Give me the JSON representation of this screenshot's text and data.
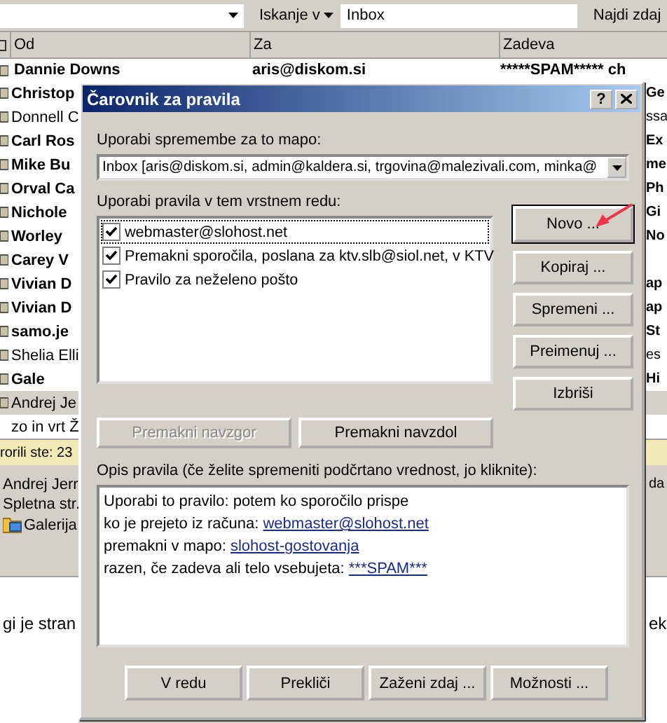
{
  "toolbar": {
    "search_in": "Iskanje v",
    "folder": "Inbox",
    "find_button": "Najdi zdaj"
  },
  "columns": [
    "Od",
    "Za",
    "Zadeva"
  ],
  "first_message": {
    "from": "Dannie Downs",
    "to": "aris@diskom.si",
    "subject": "*****SPAM***** ch",
    "unread": true
  },
  "messages": [
    {
      "from": "Christop",
      "subject": "Ge",
      "unread": true,
      "selected": false
    },
    {
      "from": "Donnell C",
      "subject": "ssa",
      "unread": false,
      "selected": false
    },
    {
      "from": "Carl Ros",
      "subject": "Ex",
      "unread": true,
      "selected": false
    },
    {
      "from": "Mike Bu",
      "subject": "me",
      "unread": true,
      "selected": false
    },
    {
      "from": "Orval Ca",
      "subject": "Ph",
      "unread": true,
      "selected": false
    },
    {
      "from": "Nichole",
      "subject": "Gi",
      "unread": true,
      "selected": false
    },
    {
      "from": "Worley",
      "subject": "No",
      "unread": true,
      "selected": false
    },
    {
      "from": "Carey V",
      "unread": true,
      "selected": false
    },
    {
      "from": "Vivian D",
      "subject": "ap",
      "unread": true,
      "selected": false
    },
    {
      "from": "Vivian D",
      "subject": "ap",
      "unread": true,
      "selected": false
    },
    {
      "from": "samo.je",
      "subject": "St",
      "unread": true,
      "selected": false
    },
    {
      "from": "Shelia Elli",
      "subject": "es",
      "unread": false,
      "selected": false
    },
    {
      "from": "Gale",
      "subject": "Hi",
      "unread": true,
      "selected": false
    },
    {
      "from": "Andrej Je",
      "unread": false,
      "selected": true
    }
  ],
  "reading_pane": {
    "subject": "zo in vrt Ž",
    "info_bar": "rorili ste: 23",
    "from": "Andrej Jerr",
    "from_right": "da",
    "to": "Spletna str.",
    "attachment": "Galerija",
    "body_left": "gi je stran",
    "body_right": "ek"
  },
  "dialog": {
    "title": "Čarovnik za pravila",
    "help": "?",
    "folder_label": "Uporabi spremembe za to mapo:",
    "folder_value": "Inbox [aris@diskom.si, admin@kaldera.si, trgovina@malezivali.com, minka@",
    "rules_label": "Uporabi pravila v tem vrstnem redu:",
    "rules": [
      {
        "name": "webmaster@slohost.net",
        "checked": true,
        "selected": true
      },
      {
        "name": "Premakni sporočila, poslana za ktv.slb@siol.net, v KTV",
        "checked": true,
        "selected": false
      },
      {
        "name": "Pravilo za neželeno pošto",
        "checked": true,
        "selected": false
      }
    ],
    "side_buttons": [
      {
        "label": "Novo ...",
        "default": true
      },
      {
        "label": "Kopiraj ...",
        "default": false
      },
      {
        "label": "Spremeni ...",
        "default": false
      },
      {
        "label": "Preimenuj ...",
        "default": false
      },
      {
        "label": "Izbriši",
        "default": false
      }
    ],
    "move_buttons": [
      {
        "label": "Premakni navzgor",
        "disabled": true
      },
      {
        "label": "Premakni navzdol",
        "disabled": false
      }
    ],
    "description_label": "Opis pravila (če želite spremeniti podčrtano vrednost, jo kliknite):",
    "description": [
      {
        "text": "Uporabi to pravilo: potem ko sporočilo prispe"
      },
      {
        "text": "ko je prejeto iz računa: ",
        "link": "webmaster@slohost.net"
      },
      {
        "text": "premakni v mapo: ",
        "link": "slohost-gostovanja"
      },
      {
        "text": "razen, če zadeva ali telo vsebujeta: ",
        "link": "***SPAM***"
      }
    ],
    "footer_buttons": [
      "V redu",
      "Prekliči",
      "Zaženi zdaj ...",
      "Možnosti ..."
    ]
  }
}
